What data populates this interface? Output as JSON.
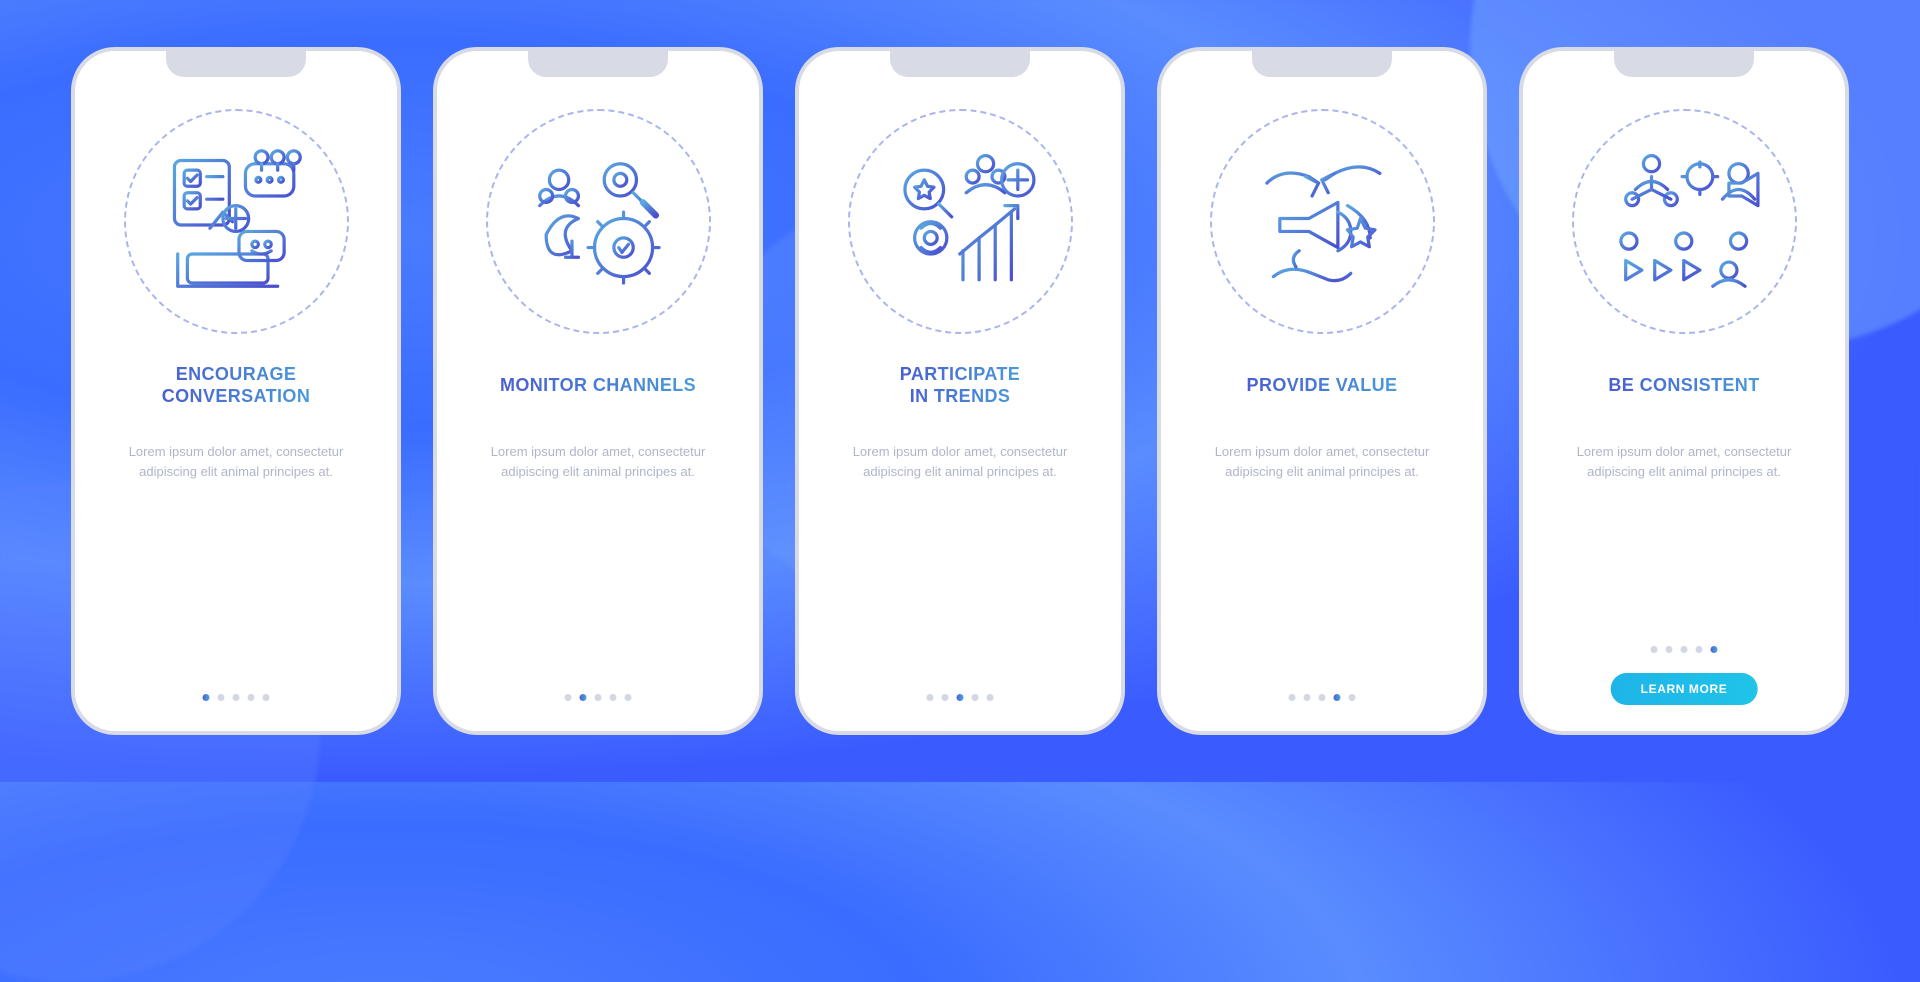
{
  "colors": {
    "background_primary": "#4a7cff",
    "phone_border": "#d8dbe6",
    "title_gradient_start": "#4a5ed0",
    "title_gradient_end": "#4a9bd8",
    "desc_text": "#b0b5c9",
    "dot_inactive": "#d3d6e4",
    "cta_gradient_start": "#1fb4e8",
    "cta_gradient_end": "#1fc4e8"
  },
  "lorem": "Lorem ipsum dolor amet, consectetur adipiscing elit animal principes at.",
  "cta_label": "LEARN MORE",
  "total_steps": 5,
  "screens": [
    {
      "title": "ENCOURAGE\nCONVERSATION",
      "icon": "encourage-conversation-icon",
      "active_index": 0,
      "has_cta": false
    },
    {
      "title": "MONITOR CHANNELS",
      "icon": "monitor-channels-icon",
      "active_index": 1,
      "has_cta": false
    },
    {
      "title": "PARTICIPATE\nIN TRENDS",
      "icon": "participate-trends-icon",
      "active_index": 2,
      "has_cta": false
    },
    {
      "title": "PROVIDE VALUE",
      "icon": "provide-value-icon",
      "active_index": 3,
      "has_cta": false
    },
    {
      "title": "BE CONSISTENT",
      "icon": "be-consistent-icon",
      "active_index": 4,
      "has_cta": true
    }
  ]
}
